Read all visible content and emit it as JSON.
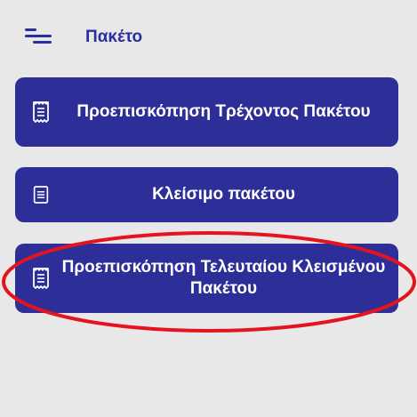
{
  "header": {
    "title": "Πακέτο",
    "menu_icon": "menu-icon"
  },
  "buttons": [
    {
      "label": "Προεπισκόπηση Τρέχοντος Πακέτου",
      "icon": "receipt-icon"
    },
    {
      "label": "Κλείσιμο πακέτου",
      "icon": "document-icon"
    },
    {
      "label": "Προεπισκόπηση Τελευταίου Κλεισμένου Πακέτου",
      "icon": "receipt-icon"
    }
  ],
  "colors": {
    "background": "#e8e8e8",
    "accent": "#2d2e98",
    "title": "#2b2e9e",
    "highlight": "#e4141f"
  }
}
